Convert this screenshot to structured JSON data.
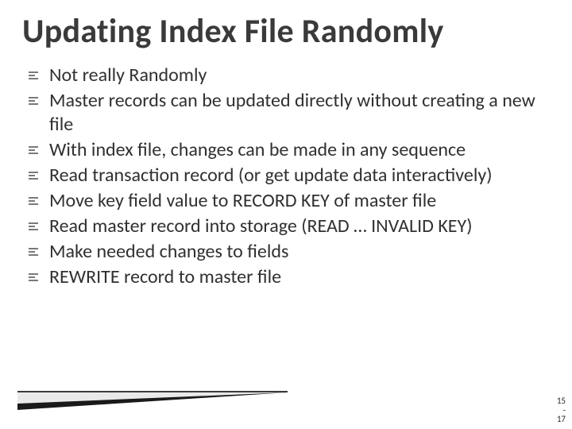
{
  "slide": {
    "title": "Updating Index File Randomly",
    "bullets": [
      "Not really Randomly",
      "Master records can be updated directly without creating a new file",
      "With index file, changes can be made in any sequence",
      "Read transaction record (or get update data interactively)",
      "Move key field value to RECORD KEY of master file",
      "Read master record into storage (READ … INVALID KEY)",
      "Make needed changes to fields",
      "REWRITE record to master file"
    ],
    "page_number": {
      "chapter": "15",
      "sep": "-",
      "page": "17"
    }
  }
}
